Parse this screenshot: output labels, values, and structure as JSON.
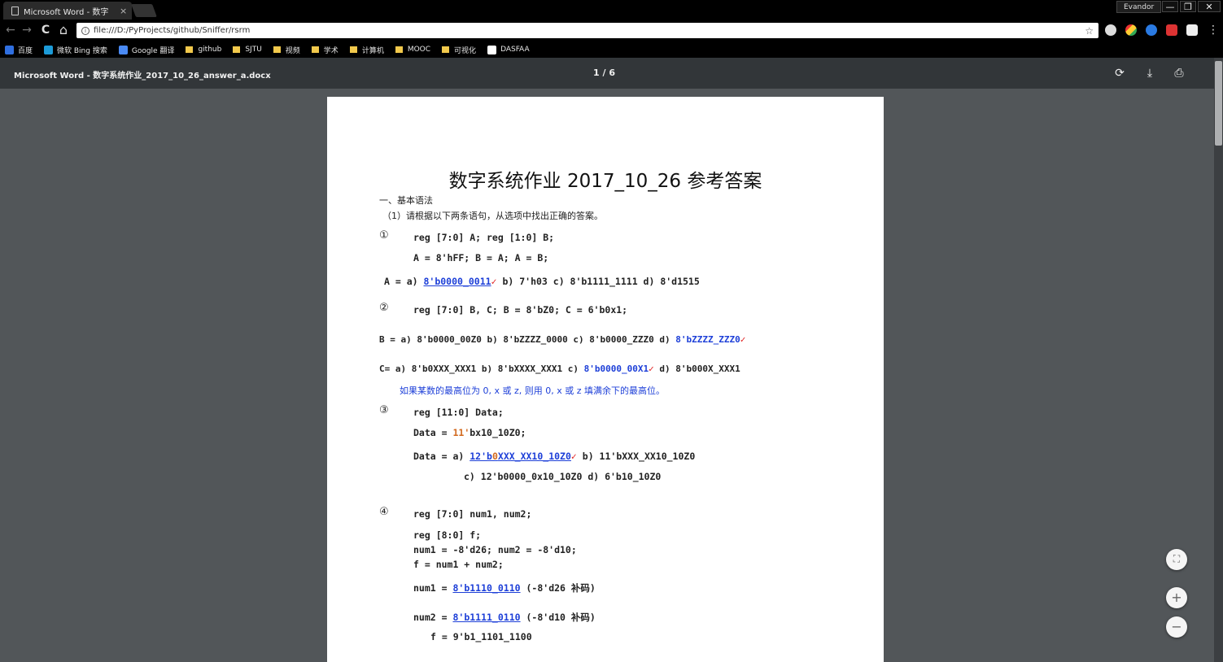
{
  "browser": {
    "tab_title": "Microsoft Word - 数字",
    "tab_close": "×",
    "profile": "Evandor",
    "window_controls": [
      "—",
      "❐",
      "✕"
    ],
    "url": "file:///D:/PyProjects/github/Sniffer/rsrm",
    "nav": {
      "back": "←",
      "forward": "→",
      "reload": "C",
      "home": "⌂"
    },
    "bookmarks": [
      {
        "label": "百度",
        "type": "site"
      },
      {
        "label": "微软 Bing 搜索",
        "type": "site"
      },
      {
        "label": "Google 翻译",
        "type": "site"
      },
      {
        "label": "github",
        "type": "folder"
      },
      {
        "label": "SJTU",
        "type": "folder"
      },
      {
        "label": "视频",
        "type": "folder"
      },
      {
        "label": "学术",
        "type": "folder"
      },
      {
        "label": "计算机",
        "type": "folder"
      },
      {
        "label": "MOOC",
        "type": "folder"
      },
      {
        "label": "可视化",
        "type": "folder"
      },
      {
        "label": "DASFAA",
        "type": "site"
      }
    ]
  },
  "pdf": {
    "title": "Microsoft Word - 数字系统作业_2017_10_26_answer_a.docx",
    "pages": "1 / 6",
    "doc_title": "数字系统作业 2017_10_26 参考答案",
    "section": "一、基本语法",
    "instruction": "（1）请根据以下两条语句，从选项中找出正确的答案。",
    "q1": {
      "num": "①",
      "line1": "reg [7:0] A;  reg [1:0] B;",
      "line2": "A = 8'hFF;    B = A;    A = B;",
      "prefix": "A =   a)",
      "answer": "8'b0000_0011",
      "check": "✓",
      "rest": "b)  7'h03  c)  8'b1111_1111    d)  8'd1515"
    },
    "q2": {
      "num": "②",
      "line1": "reg [7:0] B, C;     B = 8'bZ0;      C = 6'b0x1;",
      "b_line_pre": "B = a) 8'b0000_00Z0   b) 8'bZZZZ_0000   c)   8'b0000_ZZZ0   d)",
      "b_answer": "8'bZZZZ_ZZZ0",
      "c_line_pre": "C= a) 8'b0XXX_XXX1   b) 8'bXXXX_XXX1   c)",
      "c_answer": "8'b0000_00X1",
      "c_line_post": "d)   8'b000X_XXX1",
      "note": "如果某数的最高位为 0, x 或 z, 则用 0, x 或 z 填满余下的最高位。",
      "check": "✓"
    },
    "q3": {
      "num": "③",
      "line1": "reg [11:0] Data;",
      "line2_pre": "Data = ",
      "line2_num": "11'",
      "line2_post": "bx10_10Z0;",
      "line3_pre": "Data =  a)",
      "line3_answer_a": "12'b",
      "line3_answer_b": "0",
      "line3_answer_c": "XXX_XX10_10Z0",
      "line3_post": "b)  11'bXXX_XX10_10Z0",
      "line4": "c)  12'b0000_0x10_10Z0  d)  6'b10_10Z0",
      "check": "✓"
    },
    "q4": {
      "num": "④",
      "line1": "reg [7:0] num1, num2;",
      "line2": "reg [8:0] f;",
      "line3": "num1 = -8'd26;   num2 = -8'd10;",
      "line4": "f = num1 + num2;",
      "line5_pre": "num1 =  ",
      "line5_val": "8'b1110_0110",
      "line5_post": "(-8'd26 补码)",
      "line6_pre": "num2 =  ",
      "line6_val": "8'b1111_0110",
      "line6_post": "(-8'd10 补码)",
      "line7": "f = 9'b1_1101_1100"
    },
    "tools": {
      "rotate": "⟳",
      "download": "⤓",
      "print": "⎙"
    },
    "zoom": {
      "fit": "⛶",
      "in": "+",
      "out": "−"
    }
  }
}
